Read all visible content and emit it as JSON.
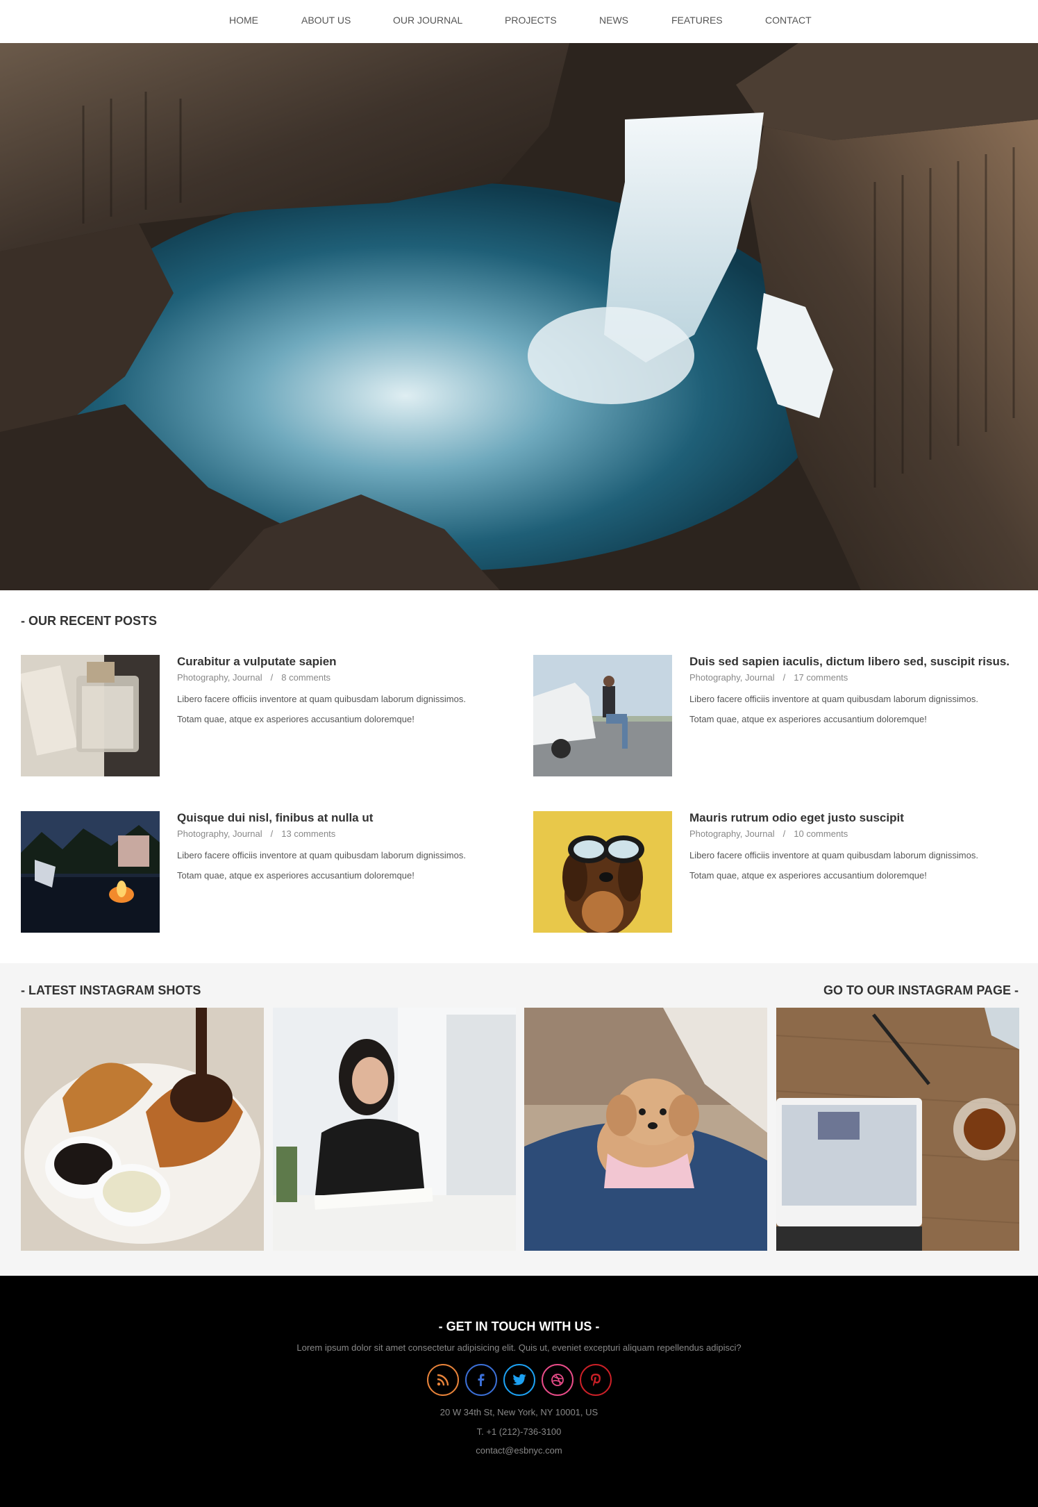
{
  "nav": {
    "items": [
      {
        "label": "HOME"
      },
      {
        "label": "ABOUT US"
      },
      {
        "label": "OUR JOURNAL"
      },
      {
        "label": "PROJECTS"
      },
      {
        "label": "NEWS"
      },
      {
        "label": "FEATURES"
      },
      {
        "label": "CONTACT"
      }
    ]
  },
  "hero": {
    "image": "waterfall-canyon-photo"
  },
  "recent_posts": {
    "heading": "- OUR RECENT POSTS",
    "posts": [
      {
        "title": "Curabitur a vulputate sapien",
        "categories": "Photography, Journal",
        "separator": "/",
        "comments": "8 comments",
        "line1": "Libero facere officiis inventore at quam quibusdam laborum dignissimos.",
        "line2": "Totam quae, atque ex asperiores accusantium doloremque!",
        "image": "perfume-bottle-photo"
      },
      {
        "title": "Duis sed sapien iaculis, dictum libero sed, suscipit risus.",
        "categories": "Photography, Journal",
        "separator": "/",
        "comments": "17 comments",
        "line1": "Libero facere officiis inventore at quam quibusdam laborum dignissimos.",
        "line2": "Totam quae, atque ex asperiores accusantium doloremque!",
        "image": "man-on-truck-photo"
      },
      {
        "title": "Quisque dui nisl, finibus at nulla ut",
        "categories": "Photography, Journal",
        "separator": "/",
        "comments": "13 comments",
        "line1": "Libero facere officiis inventore at quam quibusdam laborum dignissimos.",
        "line2": "Totam quae, atque ex asperiores accusantium doloremque!",
        "image": "campfire-night-photo"
      },
      {
        "title": "Mauris rutrum odio eget justo suscipit",
        "categories": "Photography, Journal",
        "separator": "/",
        "comments": "10 comments",
        "line1": "Libero facere officiis inventore at quam quibusdam laborum dignissimos.",
        "line2": "Totam quae, atque ex asperiores accusantium doloremque!",
        "image": "dog-with-sunglasses-photo"
      }
    ]
  },
  "instagram": {
    "heading": "- LATEST INSTAGRAM SHOTS",
    "link": "GO TO OUR INSTAGRAM PAGE -",
    "shots": [
      {
        "image": "croissants-photo"
      },
      {
        "image": "woman-writing-photo"
      },
      {
        "image": "puppy-on-pillow-photo"
      },
      {
        "image": "tablet-and-tea-photo"
      }
    ]
  },
  "footer": {
    "title": "- GET IN TOUCH WITH US -",
    "subtitle": "Lorem ipsum dolor sit amet consectetur adipisicing elit. Quis ut, eveniet excepturi aliquam repellendus adipisci?",
    "social": [
      {
        "icon": "rss-icon",
        "color": "#e8833a"
      },
      {
        "icon": "facebook-icon",
        "color": "#3b6fd6"
      },
      {
        "icon": "twitter-icon",
        "color": "#1da1f2"
      },
      {
        "icon": "dribbble-icon",
        "color": "#e94c89"
      },
      {
        "icon": "pinterest-icon",
        "color": "#cb2027"
      }
    ],
    "address": "20 W 34th St, New York, NY 10001, US",
    "phone": "T. +1 (212)-736-3100",
    "email": "contact@esbnyc.com"
  },
  "colors": {
    "footer_bg": "#000000",
    "instagram_band_bg": "#f5f5f5",
    "text_dark": "#333333",
    "text_muted": "#888888"
  }
}
